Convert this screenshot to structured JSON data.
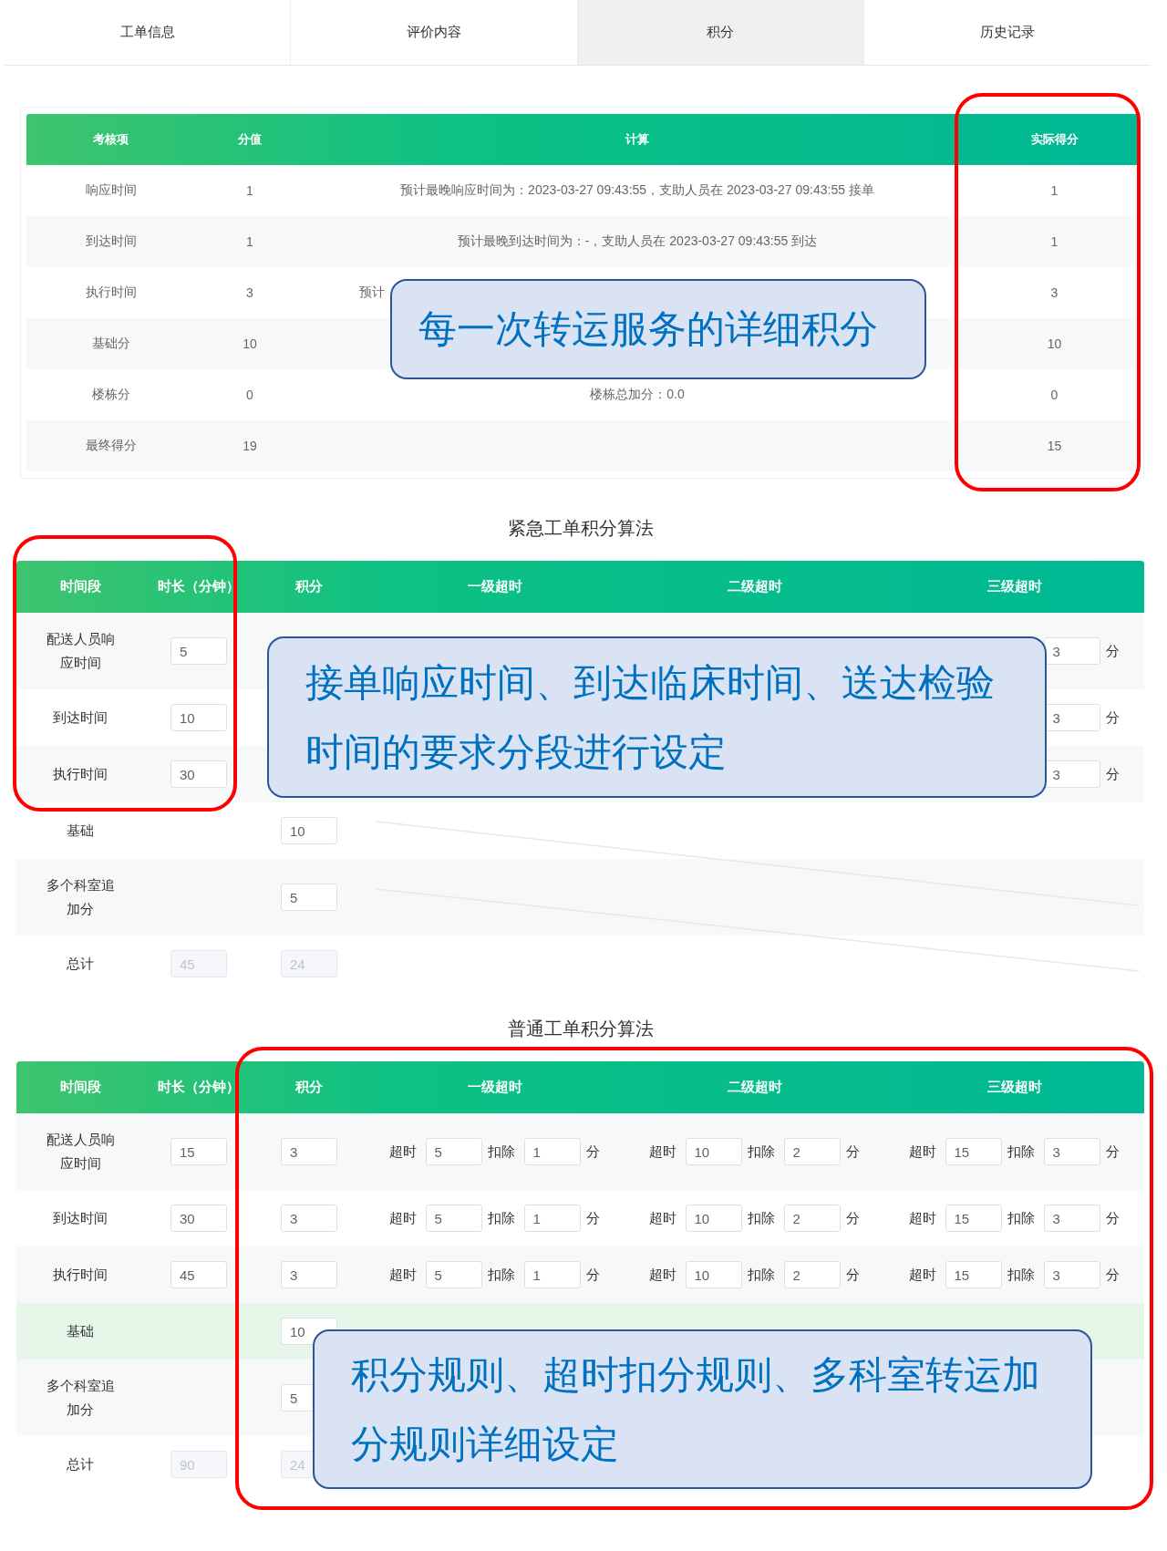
{
  "tabs": [
    {
      "label": "工单信息",
      "selected": false
    },
    {
      "label": "评价内容",
      "selected": false
    },
    {
      "label": "积分",
      "selected": true
    },
    {
      "label": "历史记录",
      "selected": false
    }
  ],
  "score_detail": {
    "columns": [
      "考核项",
      "分值",
      "计算",
      "实际得分"
    ],
    "rows": [
      {
        "item": "响应时间",
        "points": "1",
        "calculation": "预计最晚响应时间为：2023-03-27 09:43:55，支助人员在 2023-03-27 09:43:55 接单",
        "actual": "1"
      },
      {
        "item": "到达时间",
        "points": "1",
        "calculation": "预计最晚到达时间为：-，支助人员在 2023-03-27 09:43:55 到达",
        "actual": "1"
      },
      {
        "item": "执行时间",
        "points": "3",
        "calculation": "预计",
        "calculation_cut": true,
        "actual": "3"
      },
      {
        "item": "基础分",
        "points": "10",
        "actual": "10"
      },
      {
        "item": "楼栋分",
        "points": "0",
        "calculation": "楼栋总加分：0.0",
        "actual": "0"
      },
      {
        "item": "最终得分",
        "points": "19",
        "actual": "15"
      }
    ],
    "highlight_frame": true,
    "callout": "每一次转运服务的详细积分"
  },
  "urgent_rules": {
    "title": "紧急工单积分算法",
    "columns": [
      "时间段",
      "时长（分钟）",
      "积分",
      "一级超时",
      "二级超时",
      "三级超时"
    ],
    "rows": [
      {
        "name": "配送人员响应时间",
        "duration": "5",
        "third_tier": {
          "deduct": "3",
          "unit": "分"
        }
      },
      {
        "name": "到达时间",
        "duration": "10",
        "third_tier": {
          "deduct": "3",
          "unit": "分"
        }
      },
      {
        "name": "执行时间",
        "duration": "30",
        "third_tier": {
          "deduct": "3",
          "unit": "分"
        }
      },
      {
        "name": "基础",
        "score": "10"
      },
      {
        "name": "多个科室追加分",
        "score": "5"
      },
      {
        "name": "总计",
        "duration": "45",
        "score": "24",
        "disabled": true
      }
    ],
    "highlight_frame": true,
    "callout": "接单响应时间、到达临床时间、送达检验时间的要求分段进行设定"
  },
  "normal_rules": {
    "title": "普通工单积分算法",
    "columns": [
      "时间段",
      "时长（分钟）",
      "积分",
      "一级超时",
      "二级超时",
      "三级超时"
    ],
    "rows": [
      {
        "name": "配送人员响应时间",
        "duration": "15",
        "score": "3",
        "tiers": [
          {
            "over_label": "超时",
            "over": "5",
            "deduct_label": "扣除",
            "deduct": "1",
            "unit": "分"
          },
          {
            "over_label": "超时",
            "over": "10",
            "deduct_label": "扣除",
            "deduct": "2",
            "unit": "分"
          },
          {
            "over_label": "超时",
            "over": "15",
            "deduct_label": "扣除",
            "deduct": "3",
            "unit": "分"
          }
        ]
      },
      {
        "name": "到达时间",
        "duration": "30",
        "score": "3",
        "tiers": [
          {
            "over_label": "超时",
            "over": "5",
            "deduct_label": "扣除",
            "deduct": "1",
            "unit": "分"
          },
          {
            "over_label": "超时",
            "over": "10",
            "deduct_label": "扣除",
            "deduct": "2",
            "unit": "分"
          },
          {
            "over_label": "超时",
            "over": "15",
            "deduct_label": "扣除",
            "deduct": "3",
            "unit": "分"
          }
        ]
      },
      {
        "name": "执行时间",
        "duration": "45",
        "score": "3",
        "tiers": [
          {
            "over_label": "超时",
            "over": "5",
            "deduct_label": "扣除",
            "deduct": "1",
            "unit": "分"
          },
          {
            "over_label": "超时",
            "over": "10",
            "deduct_label": "扣除",
            "deduct": "2",
            "unit": "分"
          },
          {
            "over_label": "超时",
            "over": "15",
            "deduct_label": "扣除",
            "deduct": "3",
            "unit": "分"
          }
        ]
      },
      {
        "name": "基础",
        "score": "10",
        "highlighted": true
      },
      {
        "name": "多个科室追加分",
        "score": "5"
      },
      {
        "name": "总计",
        "duration": "90",
        "score": "24",
        "disabled": true
      }
    ],
    "highlight_frame": true,
    "callout": "积分规则、超时扣分规则、多科室转运加分规则详细设定"
  }
}
